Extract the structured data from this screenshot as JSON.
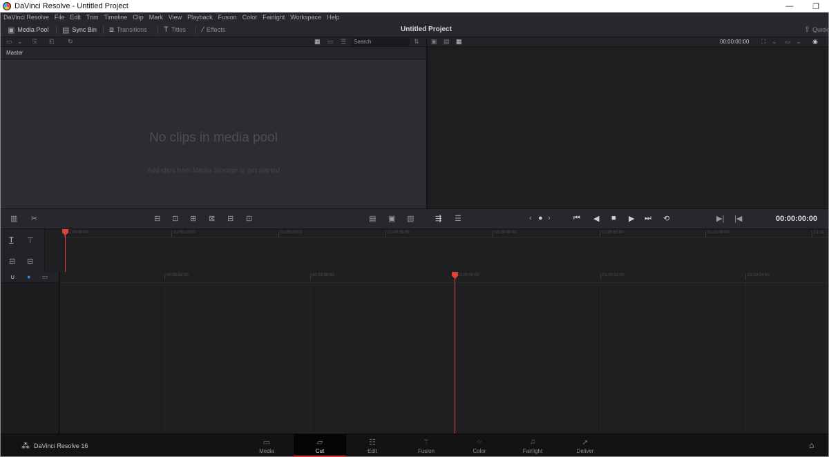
{
  "window": {
    "title": "DaVinci Resolve - Untitled Project"
  },
  "menubar": [
    "DaVinci Resolve",
    "File",
    "Edit",
    "Trim",
    "Timeline",
    "Clip",
    "Mark",
    "View",
    "Playback",
    "Fusion",
    "Color",
    "Fairlight",
    "Workspace",
    "Help"
  ],
  "toolbar": {
    "media_pool": "Media Pool",
    "sync_bin": "Sync Bin",
    "transitions": "Transitions",
    "titles": "Titles",
    "effects": "Effects",
    "project_title": "Untitled Project",
    "quick_export": "Quick"
  },
  "media_pool": {
    "search_placeholder": "Search",
    "bin": "Master",
    "empty_title": "No clips in media pool",
    "empty_subtitle": "Add clips from Media Storage to get started"
  },
  "viewer": {
    "timecode_top": "00:00:00:00",
    "timecode": "00:00:00:00"
  },
  "timeline": {
    "upper_ticks": [
      "01:00:00:00",
      "01:00:10:00",
      "01:00:20:00",
      "01:00:30:00",
      "01:00:40:00",
      "01:00:50:00",
      "01:01:00:00",
      "01:01"
    ],
    "lower_ticks": [
      "00:59:56:00",
      "00:59:58:00",
      "01:00:00:00",
      "01:00:02:00",
      "01:00:04:00"
    ]
  },
  "pages": {
    "brand": "DaVinci Resolve 16",
    "tabs": [
      "Media",
      "Cut",
      "Edit",
      "Fusion",
      "Color",
      "Fairlight",
      "Deliver"
    ],
    "active": "Cut"
  },
  "colors": {
    "accent": "#e0413a",
    "active_icon": "#4a90d9",
    "background": "#1c1c1f"
  }
}
